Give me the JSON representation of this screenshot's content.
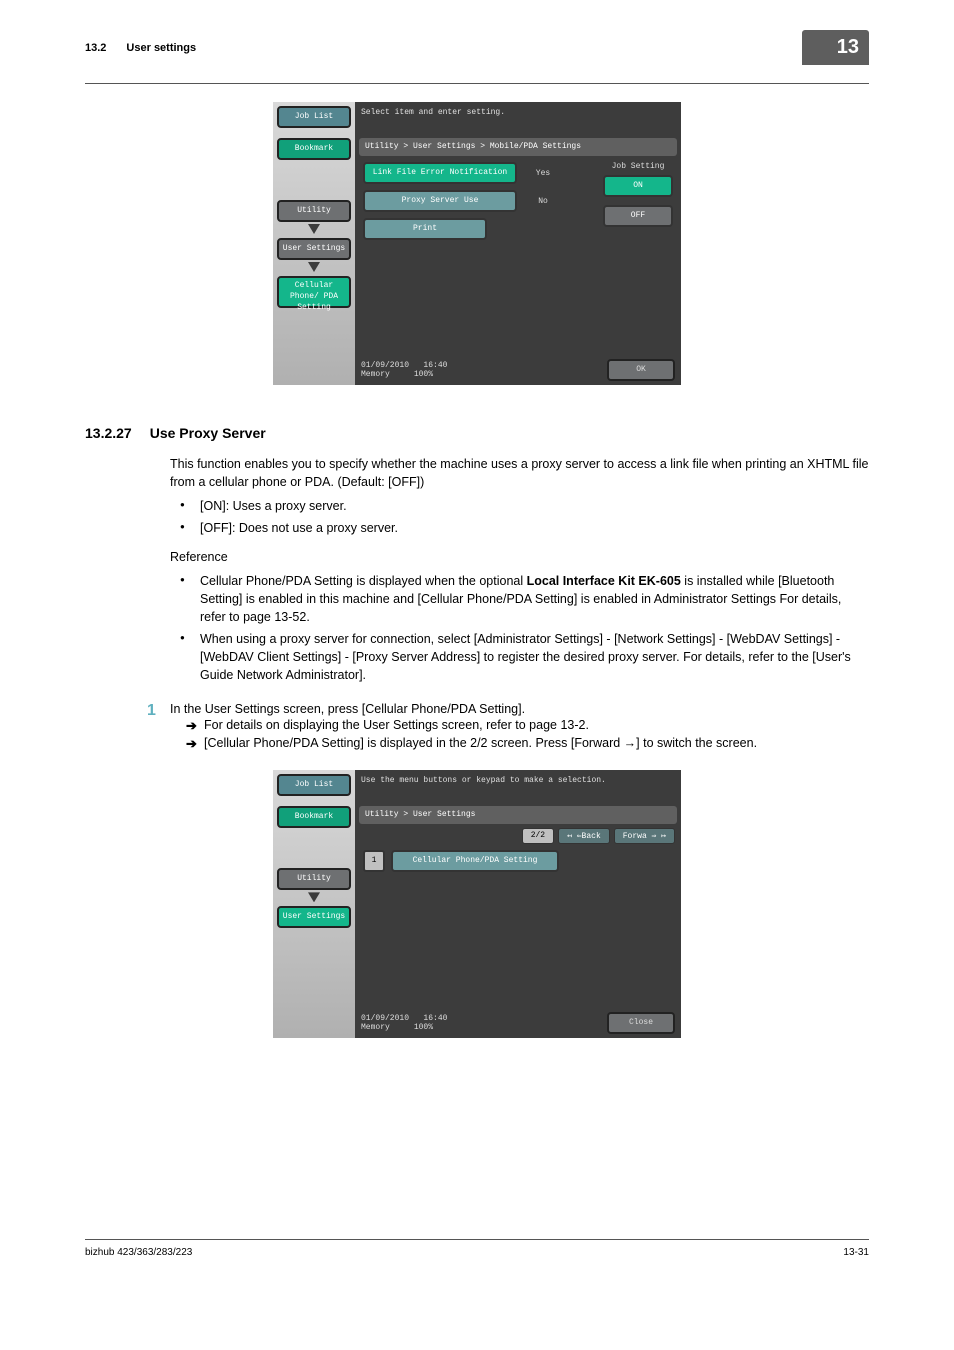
{
  "header": {
    "section_num": "13.2",
    "section_title": "User settings",
    "chapter_tab": "13"
  },
  "screenshot1": {
    "left": {
      "job_list": "Job List",
      "bookmark": "Bookmark",
      "utility": "Utility",
      "user_settings": "User Settings",
      "pda": "Cellular Phone/\nPDA Setting"
    },
    "instr": "Select item and enter setting.",
    "crumb": "Utility > User Settings > Mobile/PDA Settings",
    "rows": [
      {
        "label": "Link File Error Notification",
        "value": "Yes",
        "highlighted": true
      },
      {
        "label": "Proxy Server Use",
        "value": "No",
        "highlighted": false
      },
      {
        "label": "Print",
        "value": "",
        "highlighted": false
      }
    ],
    "side": {
      "title": "Job Setting",
      "on": "ON",
      "off": "OFF"
    },
    "footer_date": "01/09/2010",
    "footer_time": "16:40",
    "footer_mem": "Memory",
    "footer_pct": "100%",
    "ok": "OK"
  },
  "section": {
    "num": "13.2.27",
    "title": "Use Proxy Server",
    "intro": "This function enables you to specify whether the machine uses a proxy server to access a link file when printing an XHTML file from a cellular phone or PDA. (Default: [OFF])",
    "bullets": [
      "[ON]: Uses a proxy server.",
      "[OFF]: Does not use a proxy server."
    ],
    "reference": "Reference",
    "ref_bullets": [
      "Cellular Phone/PDA Setting is displayed when the optional Local Interface Kit EK-605 is installed while [Bluetooth Setting] is enabled in this machine and [Cellular Phone/PDA Setting] is enabled in Administrator Settings For details, refer to page 13-52.",
      "When using a proxy server for connection, select [Administrator Settings] - [Network Settings] - [WebDAV Settings] - [WebDAV Client Settings] - [Proxy Server Address] to register the desired proxy server. For details, refer to the [User's Guide Network Administrator]."
    ],
    "step1": {
      "num": "1",
      "text": "In the User Settings screen, press [Cellular Phone/PDA Setting].",
      "subs": [
        "For details on displaying the User Settings screen, refer to page 13-2.",
        "[Cellular Phone/PDA Setting] is displayed in the 2/2 screen. Press [Forward →] to switch the screen."
      ]
    }
  },
  "screenshot2": {
    "left": {
      "job_list": "Job List",
      "bookmark": "Bookmark",
      "utility": "Utility",
      "user_settings": "User Settings"
    },
    "instr": "Use the menu buttons or keypad to make a selection.",
    "crumb": "Utility > User Settings",
    "pager": {
      "page": "2/2",
      "back": "↤ ⇐Back",
      "fwd": "Forwa ⇒ ↦"
    },
    "menu_num": "1",
    "menu": "Cellular Phone/PDA Setting",
    "footer_date": "01/09/2010",
    "footer_time": "16:40",
    "footer_mem": "Memory",
    "footer_pct": "100%",
    "close": "Close"
  },
  "footer": {
    "model": "bizhub 423/363/283/223",
    "page": "13-31"
  }
}
